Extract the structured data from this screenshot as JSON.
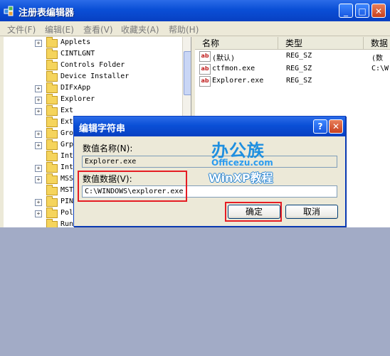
{
  "window": {
    "title": "注册表编辑器",
    "controls": {
      "minimize": "_",
      "maximize": "□",
      "close": "✕"
    }
  },
  "menu": [
    "文件(F)",
    "编辑(E)",
    "查看(V)",
    "收藏夹(A)",
    "帮助(H)"
  ],
  "tree": [
    {
      "label": "Applets",
      "expander": "+"
    },
    {
      "label": "CINTLGNT",
      "expander": ""
    },
    {
      "label": "Controls Folder",
      "expander": ""
    },
    {
      "label": "Device Installer",
      "expander": ""
    },
    {
      "label": "DIFxApp",
      "expander": "+"
    },
    {
      "label": "Explorer",
      "expander": "+"
    },
    {
      "label": "Ext",
      "expander": "+"
    },
    {
      "label": "Ext",
      "expander": ""
    },
    {
      "label": "Gro",
      "expander": "+"
    },
    {
      "label": "Grp",
      "expander": "+"
    },
    {
      "label": "Int",
      "expander": ""
    },
    {
      "label": "Int",
      "expander": "+"
    },
    {
      "label": "MSS",
      "expander": "+"
    },
    {
      "label": "MST",
      "expander": ""
    },
    {
      "label": "PIN",
      "expander": "+"
    },
    {
      "label": "Pol",
      "expander": "+"
    },
    {
      "label": "Run",
      "expander": ""
    }
  ],
  "list": {
    "columns": [
      "名称",
      "类型",
      "数据"
    ],
    "rows": [
      {
        "name": "(默认)",
        "type": "REG_SZ",
        "data": "(数"
      },
      {
        "name": "ctfmon.exe",
        "type": "REG_SZ",
        "data": "C:\\W"
      },
      {
        "name": "Explorer.exe",
        "type": "REG_SZ",
        "data": ""
      }
    ]
  },
  "dialog": {
    "title": "编辑字符串",
    "help": "?",
    "close": "✕",
    "name_label": "数值名称(N):",
    "name_value": "Explorer.exe",
    "data_label": "数值数据(V):",
    "data_value": "C:\\WINDOWS\\explorer.exe",
    "ok": "确定",
    "cancel": "取消"
  },
  "watermark": {
    "brand_cn": "办公族",
    "url": "Officezu.com",
    "tagline": "WinXP教程"
  },
  "colors": {
    "highlight": "#e51c23",
    "titlebar": "#0a4fd6",
    "desktop": "#a2abc6"
  }
}
